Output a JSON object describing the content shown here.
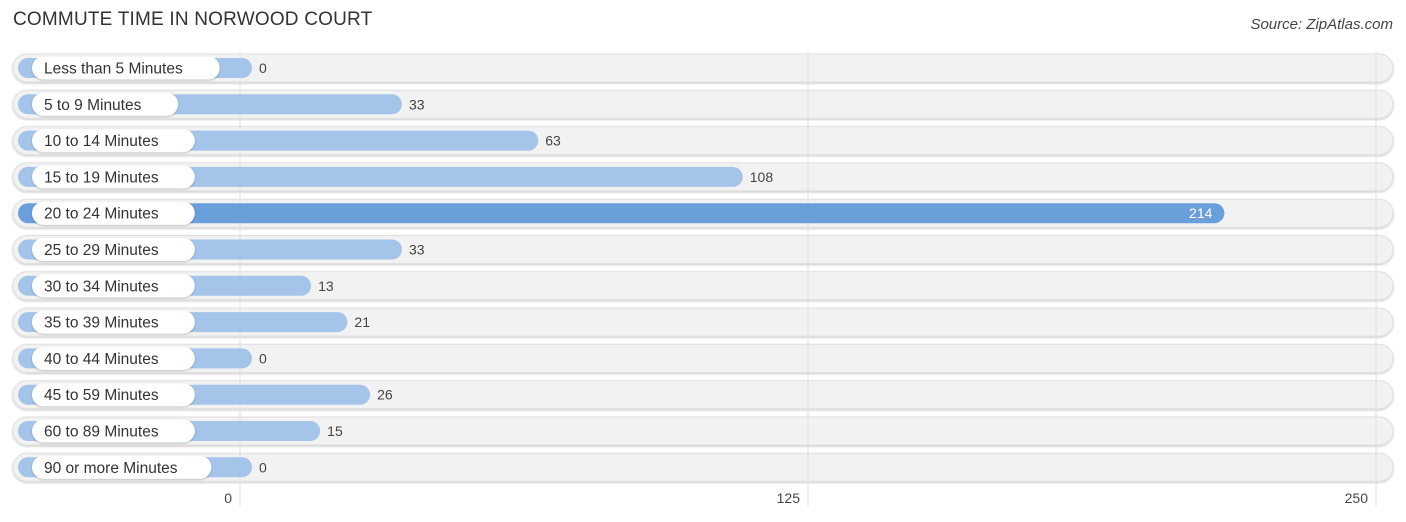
{
  "header": {
    "title": "COMMUTE TIME IN NORWOOD COURT",
    "source": "Source: ZipAtlas.com"
  },
  "colors": {
    "bar": "#a4c4ea",
    "bar_highlight": "#6a9fdc",
    "track": "#f2f2f2",
    "grid": "#dddddd"
  },
  "chart_data": {
    "type": "bar",
    "orientation": "horizontal",
    "title": "COMMUTE TIME IN NORWOOD COURT",
    "categories": [
      "Less than 5 Minutes",
      "5 to 9 Minutes",
      "10 to 14 Minutes",
      "15 to 19 Minutes",
      "20 to 24 Minutes",
      "25 to 29 Minutes",
      "30 to 34 Minutes",
      "35 to 39 Minutes",
      "40 to 44 Minutes",
      "45 to 59 Minutes",
      "60 to 89 Minutes",
      "90 or more Minutes"
    ],
    "values": [
      0,
      33,
      63,
      108,
      214,
      33,
      13,
      21,
      0,
      26,
      15,
      0
    ],
    "highlight_index": 4,
    "xlim": [
      0,
      250
    ],
    "xticks": [
      0,
      125,
      250
    ],
    "xtick_labels": [
      "0",
      "125",
      "250"
    ],
    "grid": true,
    "xlabel": "",
    "ylabel": ""
  }
}
